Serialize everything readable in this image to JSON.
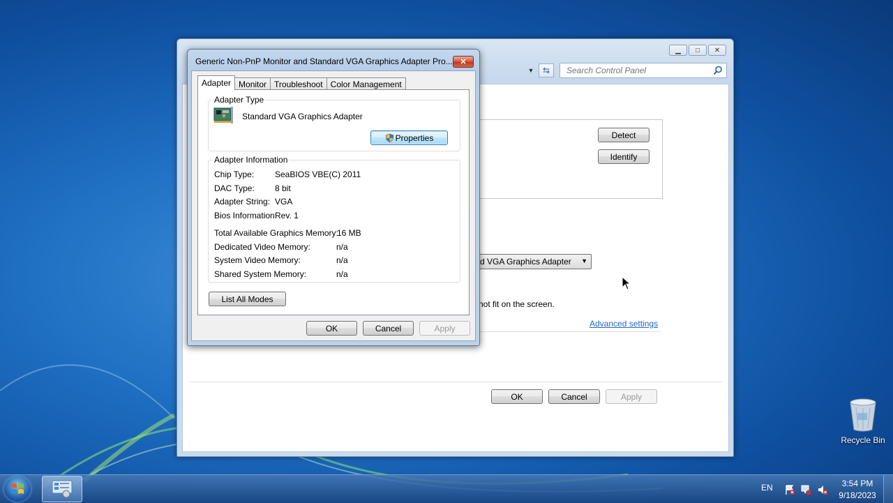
{
  "control_panel": {
    "search_placeholder": "Search Control Panel",
    "detect_label": "Detect",
    "identify_label": "Identify",
    "adapter_select_value": "rd VGA Graphics Adapter",
    "fit_text": "not fit on the screen.",
    "advanced_settings_link": "Advanced settings",
    "ok_label": "OK",
    "cancel_label": "Cancel",
    "apply_label": "Apply"
  },
  "dialog": {
    "title": "Generic Non-PnP Monitor and Standard VGA Graphics Adapter Pro...",
    "close_glyph": "✕",
    "tabs": [
      {
        "label": "Adapter",
        "active": true
      },
      {
        "label": "Monitor",
        "active": false
      },
      {
        "label": "Troubleshoot",
        "active": false
      },
      {
        "label": "Color Management",
        "active": false
      }
    ],
    "adapter_type": {
      "legend": "Adapter Type",
      "name": "Standard VGA Graphics Adapter",
      "properties_label": "Properties"
    },
    "adapter_info": {
      "legend": "Adapter Information",
      "rows": [
        {
          "label": "Chip Type:",
          "value": "SeaBIOS VBE(C) 2011"
        },
        {
          "label": "DAC Type:",
          "value": "8 bit"
        },
        {
          "label": "Adapter String:",
          "value": "VGA"
        },
        {
          "label": "Bios Information:",
          "value": "Rev. 1"
        }
      ],
      "memory_rows": [
        {
          "label": "Total Available Graphics Memory:",
          "value": "16 MB"
        },
        {
          "label": "Dedicated Video Memory:",
          "value": "n/a"
        },
        {
          "label": "System Video Memory:",
          "value": "n/a"
        },
        {
          "label": "Shared System Memory:",
          "value": "n/a"
        }
      ]
    },
    "list_all_modes_label": "List All Modes",
    "ok_label": "OK",
    "cancel_label": "Cancel",
    "apply_label": "Apply"
  },
  "desktop": {
    "recycle_bin_label": "Recycle Bin"
  },
  "taskbar": {
    "language": "EN",
    "time": "3:54 PM",
    "date": "9/18/2023"
  },
  "colors": {
    "link": "#1e67c2",
    "taskbar": "#1b4f8a",
    "close_button": "#c2371f"
  }
}
